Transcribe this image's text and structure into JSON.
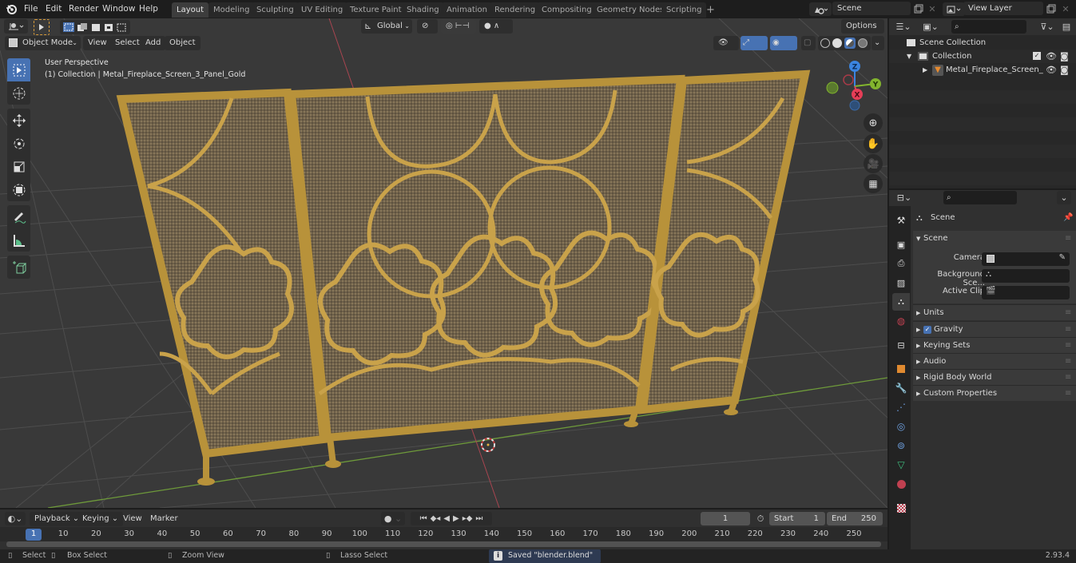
{
  "app": {
    "logo_icon": "blender-logo-icon",
    "version": "2.93.4"
  },
  "menu": [
    "File",
    "Edit",
    "Render",
    "Window",
    "Help"
  ],
  "workspaces": {
    "active": "Layout",
    "tabs": [
      "Layout",
      "Modeling",
      "Sculpting",
      "UV Editing",
      "Texture Paint",
      "Shading",
      "Animation",
      "Rendering",
      "Compositing",
      "Geometry Nodes",
      "Scripting"
    ],
    "add_label": "+"
  },
  "scene_selector": {
    "value": "Scene"
  },
  "view_layer_selector": {
    "value": "View Layer"
  },
  "viewport_header": {
    "mode": "Object Mode",
    "menus": [
      "View",
      "Select",
      "Add",
      "Object"
    ],
    "transform_orientation": "Global",
    "options_label": "Options"
  },
  "viewport": {
    "perspective_label": "User Perspective",
    "object_label": "(1) Collection | Metal_Fireplace_Screen_3_Panel_Gold",
    "gizmo_axes": {
      "z": "Z",
      "y": "Y",
      "x": "X"
    },
    "colors": {
      "background": "#393939",
      "gold": "#b8923a",
      "mesh": "#76664c",
      "x_axis": "#d3475b",
      "y_axis": "#82b52e",
      "z_axis": "#3b84e0",
      "select_active": "#4772b3"
    }
  },
  "toolbar": [
    "select-box",
    "cursor",
    "move",
    "rotate",
    "scale",
    "transform",
    "annotate",
    "measure",
    "add-cube"
  ],
  "outliner": {
    "search_placeholder": "",
    "rows": [
      {
        "label": "Scene Collection",
        "icon": "scene-collection-icon"
      },
      {
        "label": "Collection",
        "icon": "collection-icon",
        "checked": true
      },
      {
        "label": "Metal_Fireplace_Screen_",
        "icon": "mesh-object-icon"
      }
    ]
  },
  "properties": {
    "search_placeholder": "",
    "context_title": "Scene",
    "panel_title": "Scene",
    "fields": [
      {
        "label": "Camera",
        "value": ""
      },
      {
        "label": "Background Sce...",
        "value": ""
      },
      {
        "label": "Active Clip",
        "value": ""
      }
    ],
    "subpanels": [
      {
        "label": "Units"
      },
      {
        "label": "Gravity",
        "checkbox": true
      },
      {
        "label": "Keying Sets"
      },
      {
        "label": "Audio"
      },
      {
        "label": "Rigid Body World"
      },
      {
        "label": "Custom Properties"
      }
    ],
    "tabs": [
      "tool",
      "render",
      "output",
      "view-layer",
      "scene",
      "world",
      "collection",
      "object",
      "modifiers",
      "particles",
      "physics",
      "constraints",
      "data",
      "material",
      "texture"
    ]
  },
  "timeline": {
    "menus": [
      "Playback",
      "Keying",
      "View",
      "Marker"
    ],
    "current_frame": "1",
    "start_label": "Start",
    "start": "1",
    "end_label": "End",
    "end": "250",
    "ticks": [
      "1",
      "10",
      "20",
      "30",
      "40",
      "50",
      "60",
      "70",
      "80",
      "90",
      "100",
      "110",
      "120",
      "130",
      "140",
      "150",
      "160",
      "170",
      "180",
      "190",
      "200",
      "210",
      "220",
      "230",
      "240",
      "250"
    ]
  },
  "statusbar": {
    "select": "Select",
    "box_select": "Box Select",
    "zoom_view": "Zoom View",
    "lasso_select": "Lasso Select",
    "message": "Saved \"blender.blend\""
  }
}
